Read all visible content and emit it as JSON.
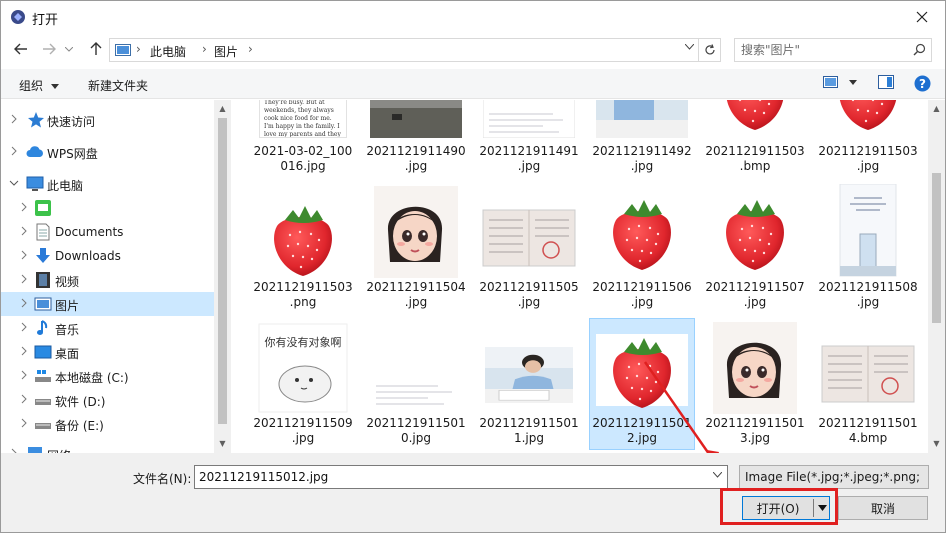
{
  "window": {
    "title": "打开"
  },
  "nav": {
    "breadcrumbs": [
      "此电脑",
      "图片"
    ],
    "search_placeholder": "搜索\"图片\""
  },
  "toolbar": {
    "organize": "组织",
    "new_folder": "新建文件夹"
  },
  "sidebar": {
    "items": [
      {
        "label": "快速访问"
      },
      {
        "label": "WPS网盘"
      },
      {
        "label": "此电脑"
      },
      {
        "label": ""
      },
      {
        "label": "Documents"
      },
      {
        "label": "Downloads"
      },
      {
        "label": "视频"
      },
      {
        "label": "图片"
      },
      {
        "label": "音乐"
      },
      {
        "label": "桌面"
      },
      {
        "label": "本地磁盘 (C:)"
      },
      {
        "label": "软件 (D:)"
      },
      {
        "label": "备份 (E:)"
      },
      {
        "label": "网络"
      }
    ]
  },
  "files": {
    "row1": [
      {
        "name": "2021-03-02_100\n016.jpg"
      },
      {
        "name": "2021121911490\n.jpg"
      },
      {
        "name": "2021121911491\n.jpg"
      },
      {
        "name": "2021121911492\n.jpg"
      },
      {
        "name": "2021121911503\n.bmp"
      },
      {
        "name": "2021121911503\n.jpg"
      }
    ],
    "row2": [
      {
        "name": "2021121911503\n.png"
      },
      {
        "name": "2021121911504\n.jpg"
      },
      {
        "name": "2021121911505\n.jpg"
      },
      {
        "name": "2021121911506\n.jpg"
      },
      {
        "name": "2021121911507\n.jpg"
      },
      {
        "name": "2021121911508\n.jpg"
      }
    ],
    "row3": [
      {
        "name": "2021121911509\n.jpg"
      },
      {
        "name": "2021121911501\n0.jpg"
      },
      {
        "name": "2021121911501\n1.jpg"
      },
      {
        "name": "2021121911501\n2.jpg"
      },
      {
        "name": "2021121911501\n3.jpg"
      },
      {
        "name": "2021121911501\n4.bmp"
      }
    ],
    "thumb_text_doc": "They're busy. But at weekends, they always cook nice food for me. I'm happy in the family. I love my parents and they love me very much.",
    "thumb_text_cartoon": "你有没有对象啊"
  },
  "footer": {
    "filename_label": "文件名(N):",
    "filename_value": "20211219115012.jpg",
    "filetype": "Image File(*.jpg;*.jpeg;*.png;",
    "open_label": "打开(O)",
    "cancel_label": "取消"
  },
  "colors": {
    "selection": "#cce8ff",
    "accent": "#0078d7",
    "annotation": "#e02020",
    "strawberry": "#e0262d"
  }
}
